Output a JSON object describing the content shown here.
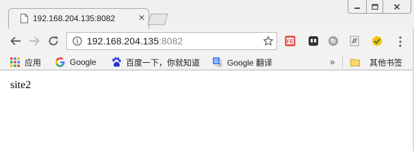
{
  "tab": {
    "title": "192.168.204.135:8082",
    "close_glyph": "✕",
    "icon": "page-icon"
  },
  "toolbar": {
    "url_host": "192.168.204.135",
    "url_port": ":8082",
    "extensions": [
      "flash-extension-icon",
      "ghost-extension-icon",
      "globe-extension-icon",
      "script-extension-icon",
      "shield-extension-icon"
    ]
  },
  "bookmarks": {
    "items": [
      {
        "label": "应用",
        "icon": "apps-grid-icon"
      },
      {
        "label": "Google",
        "icon": "google-g-icon"
      },
      {
        "label": "百度一下，你就知道",
        "icon": "baidu-paw-icon"
      },
      {
        "label": "Google 翻译",
        "icon": "google-translate-icon"
      }
    ],
    "overflow_glyph": "»",
    "other_folder": "其他书签"
  },
  "page": {
    "text": "site2"
  },
  "colors": {
    "chrome_bg": "#f2f2f2",
    "url_port": "#8a8a8a",
    "baidu_blue": "#2932e1",
    "google_translate_blue": "#4285f4"
  }
}
